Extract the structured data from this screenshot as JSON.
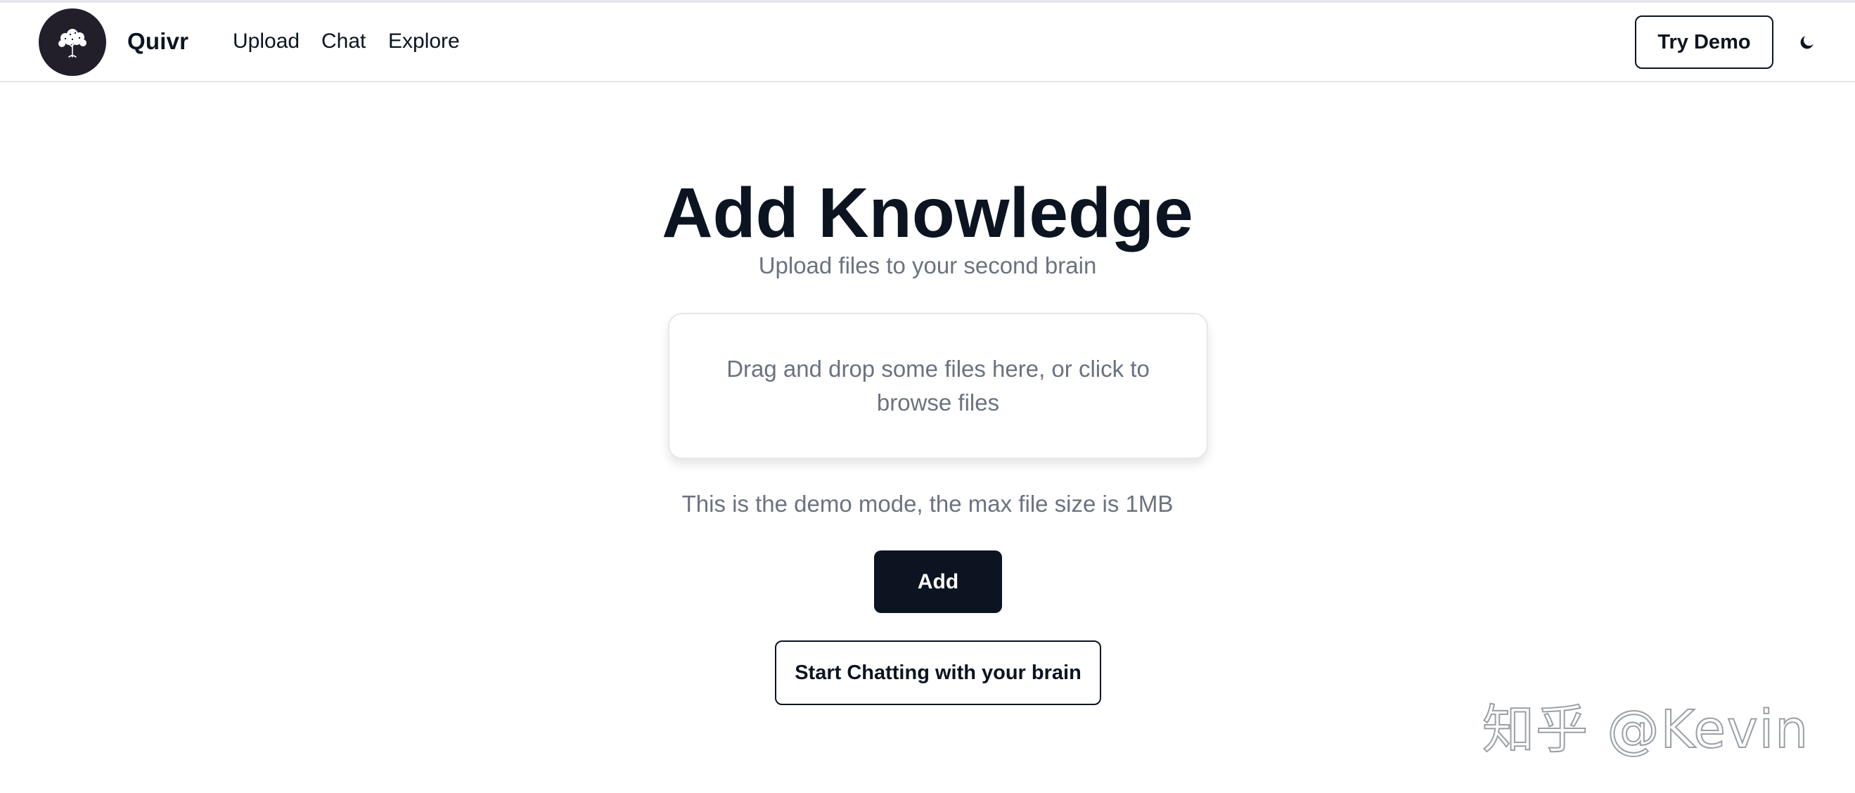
{
  "header": {
    "brand": "Quivr",
    "logo_icon": "tree-icon",
    "nav": [
      {
        "label": "Upload"
      },
      {
        "label": "Chat"
      },
      {
        "label": "Explore"
      }
    ],
    "try_demo_label": "Try Demo",
    "theme_icon": "moon-icon"
  },
  "main": {
    "title": "Add Knowledge",
    "subtitle": "Upload files to your second brain",
    "dropzone_text": "Drag and drop some files here, or click to browse files",
    "demo_note": "This is the demo mode, the max file size is 1MB",
    "add_label": "Add",
    "start_chat_label": "Start Chatting with your brain"
  },
  "watermark": "知乎 @Kevin",
  "colors": {
    "primary": "#0b1420",
    "muted_text": "#6b7280",
    "logo_bg": "#221f2a",
    "border": "#e5e7eb"
  }
}
